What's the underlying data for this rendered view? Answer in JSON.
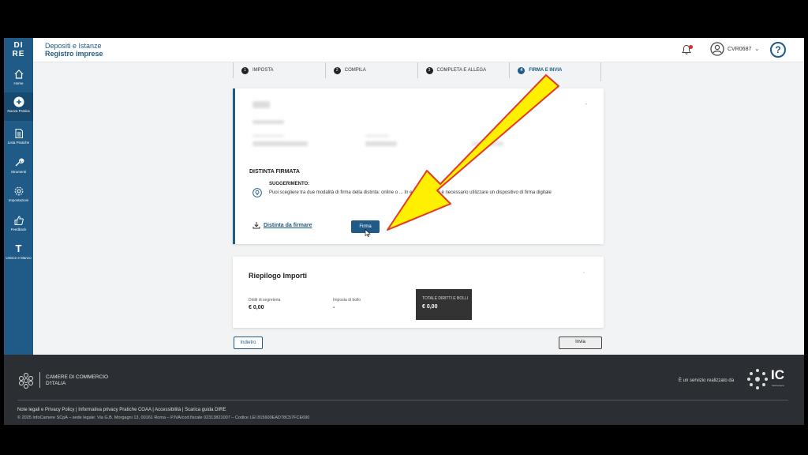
{
  "header": {
    "logo_line1": "DI",
    "logo_line2": "RE",
    "subtitle": "Depositi e Istanze",
    "title": "Registro imprese",
    "user": "CVR0687"
  },
  "sidebar": {
    "items": [
      {
        "label": "Home",
        "icon": "home-icon"
      },
      {
        "label": "Nuova Pratica",
        "icon": "plus-circle-icon"
      },
      {
        "label": "Lista Pratiche",
        "icon": "document-icon"
      },
      {
        "label": "Strumenti",
        "icon": "wrench-icon"
      },
      {
        "label": "Impostazioni",
        "icon": "gear-icon"
      },
      {
        "label": "Feedback",
        "icon": "thumbs-up-icon"
      },
      {
        "label": "Unisce e Manzo",
        "icon": "text-size-icon"
      }
    ]
  },
  "steps": [
    {
      "num": "1",
      "label": "IMPOSTA"
    },
    {
      "num": "2",
      "label": "COMPILA"
    },
    {
      "num": "3",
      "label": "COMPLETA E ALLEGA"
    },
    {
      "num": "4",
      "label": "FIRMA E INVIA"
    }
  ],
  "signature": {
    "section_title": "DISTINTA FIRMATA",
    "tip_title": "SUGGERIMENTO:",
    "tip_text": "Puoi scegliere tra due modalità di firma della distinta: online o ... In entrambi i casi è necessario utilizzare un dispositivo di firma digitale",
    "download_link": "Distinta da firmare",
    "sign_button": "Firma"
  },
  "summary": {
    "title": "Riepilogo Importi",
    "diritti_label": "Diritti di segreteria",
    "diritti_value": "€ 0,00",
    "bollo_label": "Imposta di bollo",
    "bollo_value": "-",
    "total_label": "TOTALE DIRITTI E BOLLI",
    "total_value": "€ 0,00"
  },
  "actions": {
    "back": "Indietro",
    "send": "Invia"
  },
  "footer": {
    "org_line1": "CAMERE DI COMMERCIO",
    "org_line2": "D'ITALIA",
    "service": "È un servizio realizzato da",
    "ic": "IC",
    "ic_sub": "InfoCamere",
    "links": "Note legali e Privacy Policy  |  Informativa privacy Pratiche COAA  |  Accessibilità  |  Scarica guida DIRE",
    "copyright": "© 2025 InfoCamere SCpA – sede legale: Via G.B. Morgagni 13, 00161 Roma – P.IVA/cod.fiscale 02313821007 – Codice LEI 815600EAD78C57FCE690"
  },
  "colors": {
    "brand": "#1f5b86",
    "arrow_fill": "#ffef00",
    "arrow_stroke": "#e53929"
  }
}
